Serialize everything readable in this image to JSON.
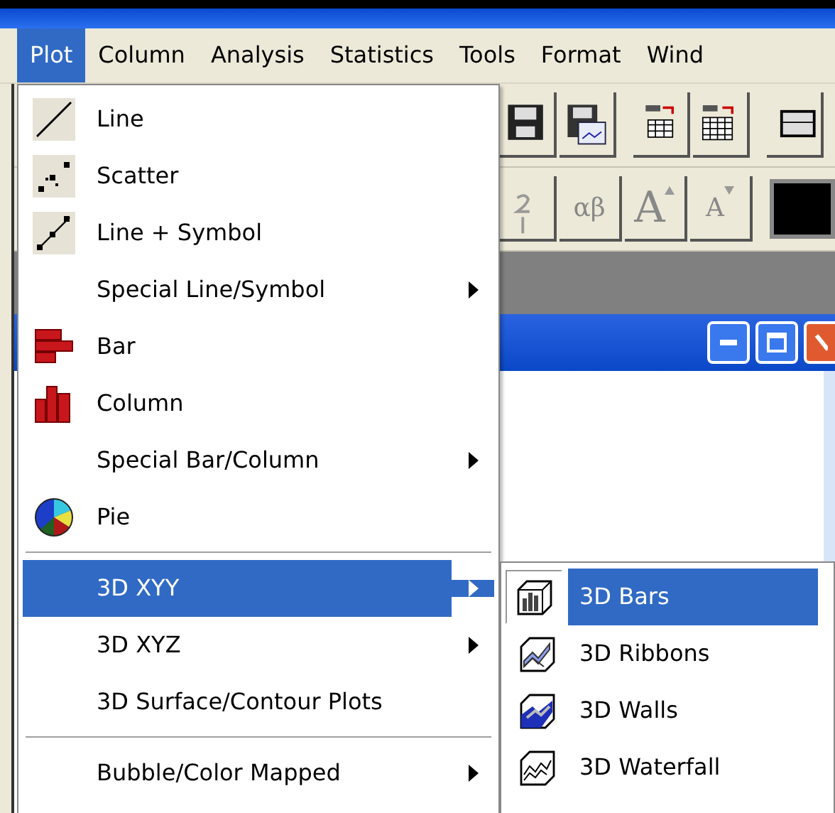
{
  "menubar": {
    "items": [
      {
        "label": "Plot",
        "selected": true
      },
      {
        "label": "Column",
        "selected": false
      },
      {
        "label": "Analysis",
        "selected": false
      },
      {
        "label": "Statistics",
        "selected": false
      },
      {
        "label": "Tools",
        "selected": false
      },
      {
        "label": "Format",
        "selected": false
      },
      {
        "label": "Wind",
        "selected": false
      }
    ]
  },
  "format_toolbar": {
    "buttons": [
      {
        "label": "αβ",
        "kind": "plain"
      },
      {
        "label": "A",
        "kind": "grow"
      },
      {
        "label": "A",
        "kind": "shrink"
      }
    ]
  },
  "plot_menu": {
    "items": [
      {
        "kind": "line",
        "label": "Line",
        "submenu": false,
        "selected": false
      },
      {
        "kind": "scatter",
        "label": "Scatter",
        "submenu": false,
        "selected": false
      },
      {
        "kind": "line-symbol",
        "label": "Line + Symbol",
        "submenu": false,
        "selected": false
      },
      {
        "kind": "plain",
        "label": "Special Line/Symbol",
        "submenu": true,
        "selected": false
      },
      {
        "kind": "bar",
        "label": "Bar",
        "submenu": false,
        "selected": false
      },
      {
        "kind": "column",
        "label": "Column",
        "submenu": false,
        "selected": false
      },
      {
        "kind": "plain",
        "label": "Special Bar/Column",
        "submenu": true,
        "selected": false
      },
      {
        "kind": "pie",
        "label": "Pie",
        "submenu": false,
        "selected": false
      },
      {
        "kind": "separator"
      },
      {
        "kind": "plain",
        "label": "3D XYY",
        "submenu": true,
        "selected": true
      },
      {
        "kind": "plain",
        "label": "3D XYZ",
        "submenu": true,
        "selected": false
      },
      {
        "kind": "plain",
        "label": "3D Surface/Contour Plots",
        "submenu": false,
        "selected": false
      },
      {
        "kind": "separator"
      },
      {
        "kind": "plain",
        "label": "Bubble/Color Mapped",
        "submenu": true,
        "selected": false
      }
    ]
  },
  "submenu": {
    "items": [
      {
        "kind": "bars3d",
        "label": "3D Bars",
        "selected": true
      },
      {
        "kind": "ribbons3d",
        "label": "3D Ribbons",
        "selected": false
      },
      {
        "kind": "walls3d",
        "label": "3D Walls",
        "selected": false
      },
      {
        "kind": "waterfall3d",
        "label": "3D Waterfall",
        "selected": false
      }
    ]
  }
}
